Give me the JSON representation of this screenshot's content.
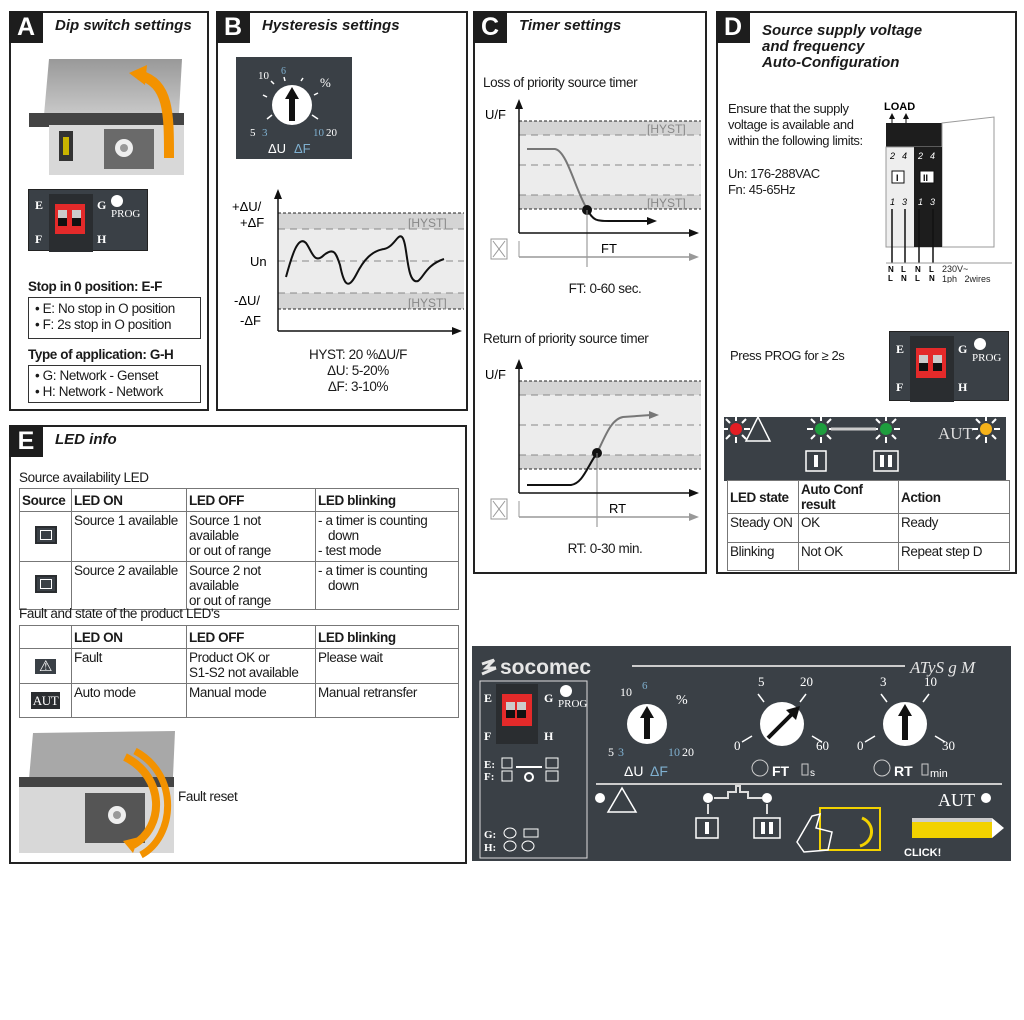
{
  "panel_a": {
    "letter": "A",
    "title": "Dip switch settings",
    "dip": {
      "e": "E",
      "f": "F",
      "g": "G",
      "h": "H",
      "prog": "PROG"
    },
    "stop_heading": "Stop in 0 position: E-F",
    "stop_items": [
      "• E: No stop in O position",
      "• F: 2s stop in O position"
    ],
    "type_heading": "Type of application: G-H",
    "type_items": [
      "• G: Network - Genset",
      "• H: Network - Network"
    ]
  },
  "panel_b": {
    "letter": "B",
    "title": "Hysteresis settings",
    "dial": {
      "t10": "10",
      "t6": "6",
      "pct": "%",
      "t5": "5",
      "t3": "3",
      "t10b": "10",
      "t20": "20",
      "du": "ΔU",
      "df": "ΔF"
    },
    "graph": {
      "plus_label1": "+ΔU/",
      "plus_label2": "+ΔF",
      "un": "Un",
      "minus_label1": "-ΔU/",
      "minus_label2": "-ΔF",
      "hyst": "[HYST]"
    },
    "notes": [
      "HYST: 20 %ΔU/F",
      "ΔU: 5-20%",
      "ΔF: 3-10%"
    ]
  },
  "panel_c": {
    "letter": "C",
    "title": "Timer settings",
    "loss_heading": "Loss of priority source timer",
    "axis_label": "U/F",
    "hyst": "[HYST]",
    "ft": "FT",
    "ft_range": "FT: 0-60 sec.",
    "return_heading": "Return of priority source timer",
    "rt": "RT",
    "rt_range": "RT: 0-30 min."
  },
  "panel_d": {
    "letter": "D",
    "title": [
      "Source supply voltage",
      "and frequency",
      "Auto-Configuration"
    ],
    "intro": [
      "Ensure that the supply",
      "voltage is available and",
      "within the following limits:"
    ],
    "un": "Un: 176-288VAC",
    "fn": "Fn: 45-65Hz",
    "wiring": {
      "load": "LOAD",
      "top": [
        "2",
        "4",
        "2",
        "4"
      ],
      "bottom": [
        "1",
        "3",
        "1",
        "3"
      ],
      "src1": "I",
      "src2": "II",
      "row1": [
        "N",
        "L",
        "N",
        "L"
      ],
      "row2": [
        "L",
        "N",
        "L",
        "N"
      ],
      "spec1": "230V~",
      "spec2": "1ph   2wires"
    },
    "press": "Press PROG for ≥ 2s",
    "led_bar": {
      "aut": "AUT",
      "colors": {
        "fault": "#e31e24",
        "s1": "#1e9e3e",
        "s2": "#1e9e3e",
        "aut": "#f5b21a"
      }
    },
    "table": {
      "headers": [
        "LED state",
        "Auto Conf result",
        "Action"
      ],
      "rows": [
        [
          "Steady ON",
          "OK",
          "Ready"
        ],
        [
          "Blinking",
          "Not OK",
          "Repeat step D"
        ]
      ]
    }
  },
  "panel_e": {
    "letter": "E",
    "title": "LED info",
    "source_heading": "Source availability LED",
    "source_table": {
      "headers": [
        "Source",
        "LED ON",
        "LED OFF",
        "LED blinking"
      ],
      "rows": [
        {
          "icon": "I",
          "on": "Source 1 available",
          "off": [
            "Source 1 not available",
            "or out of range"
          ],
          "blink": [
            "- a timer is counting",
            "   down",
            "- test mode"
          ]
        },
        {
          "icon": "II",
          "on": "Source 2 available",
          "off": [
            "Source 2 not available",
            "or out of range"
          ],
          "blink": [
            "- a timer is counting",
            "   down"
          ]
        }
      ]
    },
    "fault_heading": "Fault and state of the product LED's",
    "fault_table": {
      "headers": [
        "",
        "LED ON",
        "LED OFF",
        "LED blinking"
      ],
      "rows": [
        {
          "icon": "⚠",
          "on": "Fault",
          "off": [
            "Product OK or",
            "S1-S2 not available"
          ],
          "blink": "Please wait"
        },
        {
          "icon": "AUT",
          "on": "Auto mode",
          "off": [
            "Manual mode"
          ],
          "blink": "Manual retransfer"
        }
      ]
    },
    "fault_reset": "Fault reset"
  },
  "device": {
    "brand": "socomec",
    "model": "ATyS g M",
    "dip": {
      "e": "E",
      "f": "F",
      "g": "G",
      "h": "H",
      "prog": "PROG"
    },
    "ef_legend": {
      "e": "E:",
      "f": "F:"
    },
    "gh_legend": {
      "g": "G:",
      "h": "H:"
    },
    "dial1": {
      "t10": "10",
      "t6": "6",
      "pct": "%",
      "t5": "5",
      "t3": "3",
      "t10b": "10",
      "t20": "20",
      "du": "ΔU",
      "df": "ΔF"
    },
    "dial2": {
      "t5": "5",
      "t20": "20",
      "t0": "0",
      "t60": "60",
      "label": "FT",
      "unit": "s"
    },
    "dial3": {
      "t3": "3",
      "t10": "10",
      "t0": "0",
      "t30": "30",
      "label": "RT",
      "unit": "min"
    },
    "aut": "AUT",
    "click": "CLICK!"
  },
  "colors": {
    "dark_panel": "#3a4046",
    "accent_orange": "#f39200",
    "accent_blue": "#7fb0d0",
    "dip_red": "#e42a2a",
    "yellow": "#f2d200"
  }
}
